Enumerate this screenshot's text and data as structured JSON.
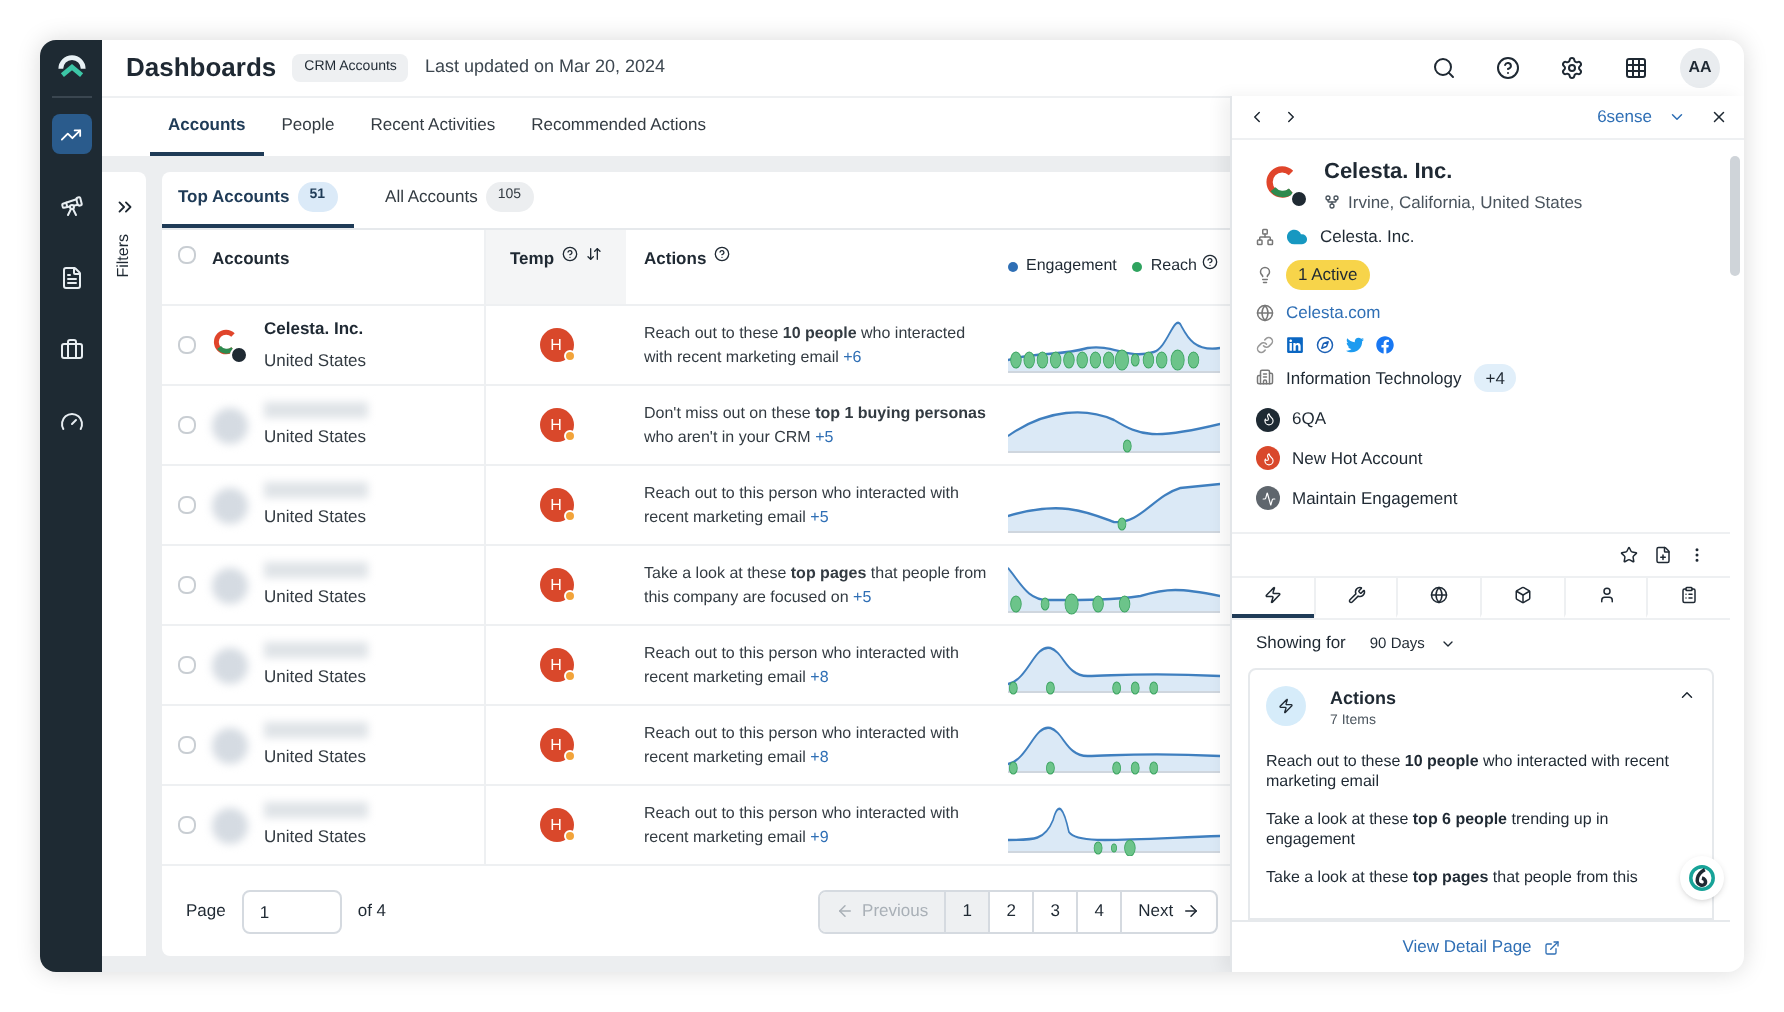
{
  "header": {
    "title": "Dashboards",
    "badge": "CRM Accounts",
    "updated": "Last updated on Mar 20, 2024",
    "avatar": "AA"
  },
  "tabs": [
    {
      "label": "Accounts",
      "selected": true
    },
    {
      "label": "People",
      "selected": false
    },
    {
      "label": "Recent Activities",
      "selected": false
    },
    {
      "label": "Recommended Actions",
      "selected": false
    }
  ],
  "filters_label": "Filters",
  "subtabs": [
    {
      "label": "Top Accounts",
      "count": "51",
      "selected": true
    },
    {
      "label": "All Accounts",
      "count": "105",
      "selected": false
    }
  ],
  "table": {
    "select_all_checked": false,
    "columns": [
      "Accounts",
      "Temp",
      "Actions"
    ],
    "legend": [
      {
        "label": "Engagement",
        "color": "#2f6fb5"
      },
      {
        "label": "Reach",
        "color": "#2fa35f"
      }
    ],
    "rows": [
      {
        "checked": false,
        "name": "Celesta. Inc.",
        "country": "United States",
        "temp": "H",
        "action": "Reach out to these **10 people** who interacted with recent marketing email",
        "more": "+6"
      },
      {
        "checked": false,
        "country": "United States",
        "temp": "H",
        "action": "Don't miss out on these **top 1 buying personas** who aren't in your CRM",
        "more": "+5"
      },
      {
        "checked": false,
        "country": "United States",
        "temp": "H",
        "action": "Reach out to this person who interacted with recent marketing email",
        "more": "+5"
      },
      {
        "checked": false,
        "country": "United States",
        "temp": "H",
        "action": "Take a look at these **top pages** that people from this company are focused on",
        "more": "+5"
      },
      {
        "checked": false,
        "country": "United States",
        "temp": "H",
        "action": "Reach out to this person who interacted with recent marketing email",
        "more": "+8"
      },
      {
        "checked": false,
        "country": "United States",
        "temp": "H",
        "action": "Reach out to this person who interacted with recent marketing email",
        "more": "+8"
      },
      {
        "checked": false,
        "country": "United States",
        "temp": "H",
        "action": "Reach out to this person who interacted with recent marketing email",
        "more": "+9"
      }
    ]
  },
  "pagination": {
    "label": "Page",
    "value": "1",
    "of": "of 4",
    "previous": {
      "label": "Previous",
      "disabled": true
    },
    "pages": [
      {
        "label": "1",
        "selected": true
      },
      {
        "label": "2",
        "selected": false
      },
      {
        "label": "3",
        "selected": false
      },
      {
        "label": "4",
        "selected": false
      }
    ],
    "next": {
      "label": "Next",
      "disabled": false
    }
  },
  "panel": {
    "source": "6sense",
    "company": "Celesta. Inc.",
    "location": "Irvine, California, United States",
    "crm": "Celesta. Inc.",
    "status": "1 Active",
    "website": "Celesta.com",
    "industry": "Information Technology",
    "industry_more": "+4",
    "segments": [
      {
        "kind": "stage",
        "label": "6QA"
      },
      {
        "kind": "hot",
        "label": "New Hot Account"
      },
      {
        "kind": "engage",
        "label": "Maintain Engagement"
      }
    ],
    "tabs": [
      {
        "kind": "actions",
        "selected": true
      },
      {
        "kind": "tools",
        "selected": false
      },
      {
        "kind": "web",
        "selected": false
      },
      {
        "kind": "product",
        "selected": false
      },
      {
        "kind": "people",
        "selected": false
      },
      {
        "kind": "notes",
        "selected": false
      }
    ],
    "showing_label": "Showing for",
    "period": "90 Days",
    "actions": {
      "title": "Actions",
      "count": "7 Items",
      "expanded": true,
      "items": [
        "Reach out to these **10 people** who interacted with recent marketing email",
        "Take a look at these **top 6 people** trending up in engagement",
        "Take a look at these **top pages** that people from this"
      ]
    },
    "footer": "View Detail Page"
  }
}
